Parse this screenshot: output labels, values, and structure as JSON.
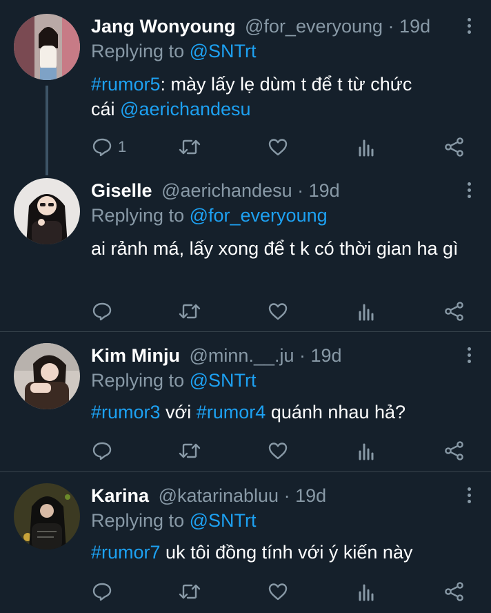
{
  "replies": [
    {
      "name": "Jang Wonyoung",
      "handle": "@for_everyoung",
      "time": "19d",
      "replying_prefix": "Replying to ",
      "replying_to": "@SNTrt",
      "hashtag": "#rumor5",
      "text_a": ": mày lấy lẹ dùm t để t từ chức",
      "text_b": "cái ",
      "mention": "@aerichandesu",
      "reply_count": "1"
    },
    {
      "name": "Giselle",
      "handle": "@aerichandesu",
      "time": "19d",
      "replying_prefix": "Replying to ",
      "replying_to": "@for_everyoung",
      "text": "ai rảnh má, lấy xong để t k có thời gian ha gì"
    },
    {
      "name": "Kim Minju",
      "handle": "@minn.__.ju",
      "time": "19d",
      "replying_prefix": "Replying to ",
      "replying_to": "@SNTrt",
      "hashtag1": "#rumor3",
      "mid": " với ",
      "hashtag2": "#rumor4",
      "tail": " quánh nhau hả?"
    },
    {
      "name": "Karina",
      "handle": "@katarinabluu",
      "time": "19d",
      "replying_prefix": "Replying to ",
      "replying_to": "@SNTrt",
      "hashtag": "#rumor7",
      "tail": " uk tôi đồng tính với ý kiến này"
    }
  ],
  "separator": " · ",
  "colors": {
    "background": "#15202b",
    "link": "#1da1f2",
    "muted": "#8899a6",
    "divider": "#38444d"
  },
  "icons": [
    "reply-icon",
    "retweet-icon",
    "like-icon",
    "analytics-icon",
    "share-icon",
    "more-icon"
  ]
}
